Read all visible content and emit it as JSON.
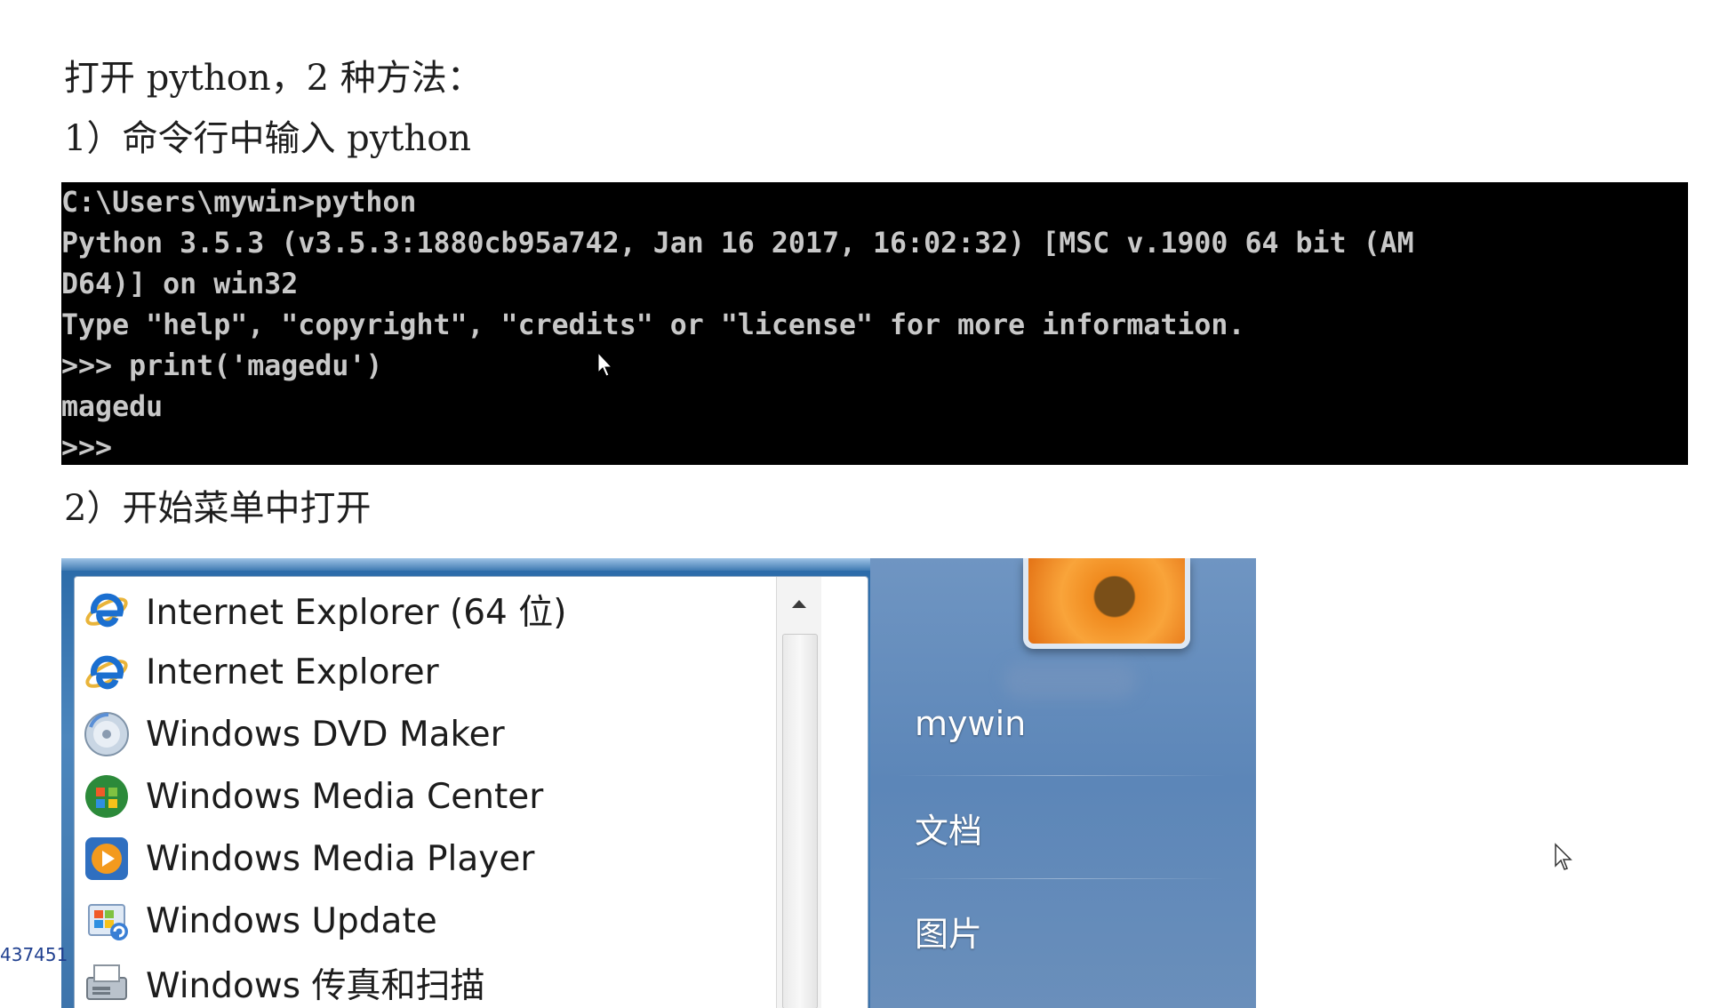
{
  "headings": {
    "intro": "打开 python，2 种方法：",
    "method1": "1）命令行中输入 python",
    "method2": "2）开始菜单中打开"
  },
  "console": {
    "lines": [
      "C:\\Users\\mywin>python",
      "Python 3.5.3 (v3.5.3:1880cb95a742, Jan 16 2017, 16:02:32) [MSC v.1900 64 bit (AM",
      "D64)] on win32",
      "Type \"help\", \"copyright\", \"credits\" or \"license\" for more information.",
      ">>> print('magedu')",
      "magedu",
      ">>>"
    ]
  },
  "start_menu": {
    "programs": [
      {
        "label": "Internet Explorer (64 位)",
        "icon": "internet-explorer-icon"
      },
      {
        "label": "Internet Explorer",
        "icon": "internet-explorer-icon"
      },
      {
        "label": "Windows DVD Maker",
        "icon": "dvd-maker-icon"
      },
      {
        "label": "Windows Media Center",
        "icon": "media-center-icon"
      },
      {
        "label": "Windows Media Player",
        "icon": "media-player-icon"
      },
      {
        "label": "Windows Update",
        "icon": "windows-update-icon"
      },
      {
        "label": "Windows 传真和扫描",
        "icon": "fax-scan-icon"
      }
    ],
    "right_items": {
      "user": "mywin",
      "documents": "文档",
      "pictures": "图片"
    }
  },
  "side_code": "437451",
  "colors": {
    "console_bg": "#000000",
    "console_text": "#c8c8c8",
    "menu_blue": "#4c86bd",
    "right_panel": "#5c86b8"
  }
}
